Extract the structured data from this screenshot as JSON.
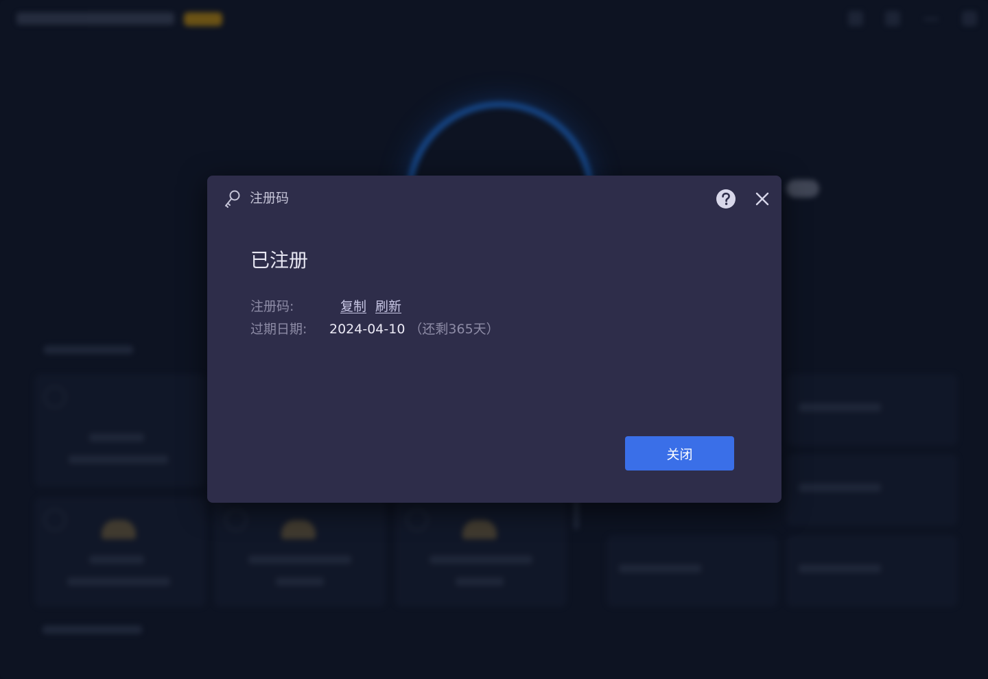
{
  "dialog": {
    "title": "注册码",
    "status": "已注册",
    "code_label": "注册码:",
    "copy_link": "复制",
    "refresh_link": "刷新",
    "expiry_label": "过期日期:",
    "expiry_date": "2024-04-10",
    "remaining": "（还剩365天）",
    "close_button": "关闭"
  },
  "icons": {
    "title": "key-icon",
    "help": "help-icon",
    "close": "close-icon"
  },
  "colors": {
    "dialog_bg": "#2e2d4a",
    "primary_button": "#3a6fe8",
    "app_bg": "#0d1322",
    "ring_accent": "#1d6fd8"
  }
}
